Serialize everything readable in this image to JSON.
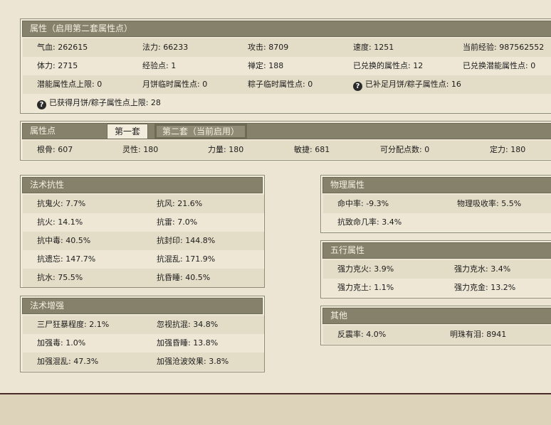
{
  "attr_panel": {
    "title": "属性（启用第二套属性点）",
    "row1": [
      "气血: 262615",
      "法力: 66233",
      "攻击: 8709",
      "速度: 1251",
      "当前经验: 987562552"
    ],
    "row2": [
      "体力: 2715",
      "经验点: 1",
      "禅定: 188",
      "已兑换的属性点: 12",
      "已兑换潜能属性点: 0"
    ],
    "row3": [
      "潜能属性点上限: 0",
      "月饼临时属性点: 0",
      "粽子临时属性点: 0",
      "已补足月饼/粽子属性点: 16"
    ],
    "row4": [
      "已获得月饼/粽子属性点上限: 28"
    ],
    "help_icon": "?"
  },
  "points_panel": {
    "title": "属性点",
    "tabs": [
      "第一套",
      "第二套（当前启用）"
    ],
    "values": [
      "根骨: 607",
      "灵性: 180",
      "力量: 180",
      "敏捷: 681",
      "可分配点数: 0",
      "定力: 180"
    ]
  },
  "resist_panel": {
    "title": "法术抗性",
    "rows": [
      [
        "抗鬼火: 7.7%",
        "抗风: 21.6%"
      ],
      [
        "抗火: 14.1%",
        "抗雷: 7.0%"
      ],
      [
        "抗中毒: 40.5%",
        "抗封印: 144.8%"
      ],
      [
        "抗遗忘: 147.7%",
        "抗混乱: 171.9%"
      ],
      [
        "抗水: 75.5%",
        "抗昏睡: 40.5%"
      ]
    ]
  },
  "enhance_panel": {
    "title": "法术增强",
    "rows": [
      [
        "三尸狂暴程度: 2.1%",
        "忽视抗混: 34.8%"
      ],
      [
        "加强毒: 1.0%",
        "加强昏睡: 13.8%"
      ],
      [
        "加强混乱: 47.3%",
        "加强沧波效果: 3.8%"
      ]
    ]
  },
  "phys_panel": {
    "title": "物理属性",
    "rows": [
      [
        "命中率: -9.3%",
        "物理吸收率: 5.5%"
      ],
      [
        "抗致命几率: 3.4%",
        ""
      ]
    ]
  },
  "element_panel": {
    "title": "五行属性",
    "rows": [
      [
        "强力克火: 3.9%",
        "强力克水: 3.4%"
      ],
      [
        "强力克土: 1.1%",
        "强力克金: 13.2%"
      ]
    ]
  },
  "other_panel": {
    "title": "其他",
    "rows": [
      [
        "反震率: 4.0%",
        "明珠有泪: 8941"
      ]
    ]
  }
}
